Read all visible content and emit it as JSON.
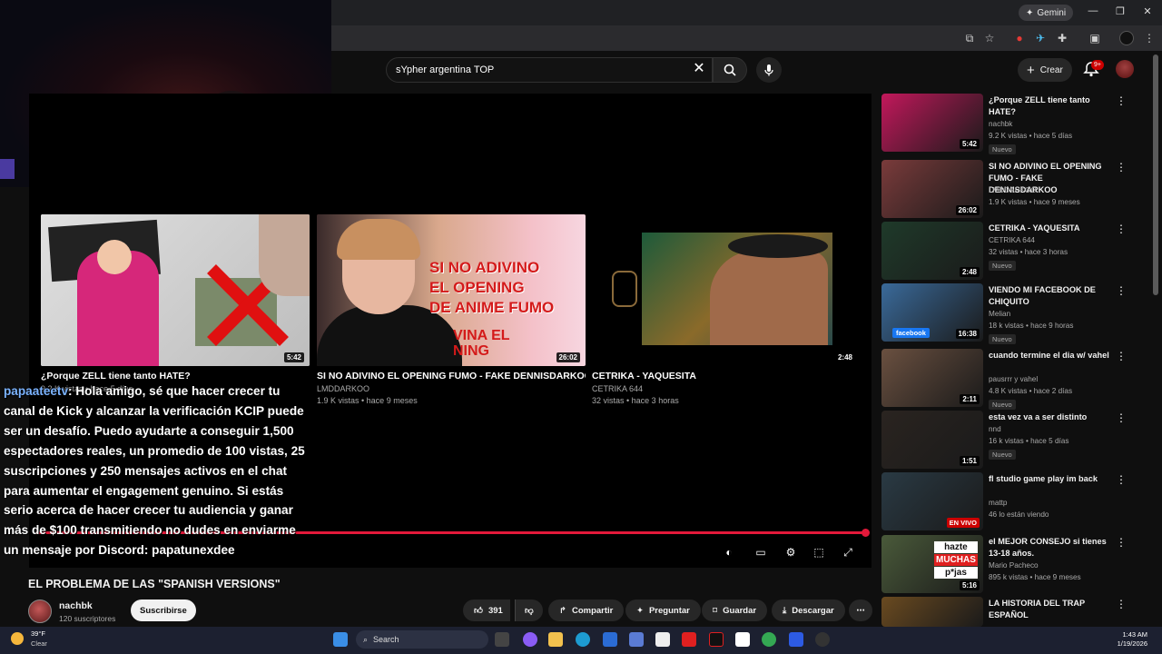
{
  "browser": {
    "gemini_label": "Gemini"
  },
  "youtube": {
    "search": {
      "query": "sYpher argentina TOP"
    },
    "create_label": "Crear",
    "notification_count": "9+"
  },
  "endscreen": [
    {
      "title": "¿Porque ZELL tiene tanto HATE?",
      "channel": "",
      "views": "9.2 K vistas • hace 5 días",
      "duration": "5:42"
    },
    {
      "title": "SI NO ADIVINO EL OPENING FUMO - FAKE DENNISDARKOO",
      "channel": "LMDDARKOO",
      "views": "1.9 K vistas • hace 9 meses",
      "duration": "26:02"
    },
    {
      "title": "CETRIKA - YAQUESITA",
      "channel": "CETRIKA 644",
      "views": "32 vistas • hace 3 horas",
      "duration": "2:48"
    }
  ],
  "thumb_text": {
    "t2_line1": "SI NO ADIVINO",
    "t2_line2": "EL OPENING",
    "t2_line3": "DE ANIME FUMO",
    "t2_line4": "VINA EL",
    "t2_line5": "NING"
  },
  "chat": {
    "username": "papaateetv",
    "message": ": Hola amigo, sé que hacer crecer tu canal de Kick y alcanzar la verificación KCIP puede ser un desafío. Puedo ayudarte a conseguir 1,500 espectadores reales, un promedio de 100 vistas, 25 suscripciones y 250 mensajes activos en el chat para aumentar el engagement genuino. Si estás serio acerca de hacer crecer tu audiencia y ganar más de $100 transmitiendo no dudes en enviarme un mensaje por Discord: papatunexdee"
  },
  "video": {
    "title": "EL PROBLEMA DE LAS \"SPANISH VERSIONS\"",
    "channel": "nachbk",
    "subscribers": "120 suscriptores",
    "subscribe_label": "Suscribirse",
    "likes": "391",
    "share_label": "Compartir",
    "ask_label": "Preguntar",
    "save_label": "Guardar",
    "download_label": "Descargar"
  },
  "recommendations": [
    {
      "title": "¿Porque ZELL tiene tanto HATE?",
      "channel": "nachbk",
      "views": "9.2 K vistas • hace 5 días",
      "badge": "Nuevo",
      "duration": "5:42",
      "color": "#c2185b"
    },
    {
      "title": "SI NO ADIVINO EL OPENING FUMO - FAKE DENNISDARKOO",
      "channel": "LMDDARKOO",
      "views": "1.9 K vistas • hace 9 meses",
      "badge": "",
      "duration": "26:02",
      "color": "#7a3b3b"
    },
    {
      "title": "CETRIKA - YAQUESITA",
      "channel": "CETRIKA 644",
      "views": "32 vistas • hace 3 horas",
      "badge": "Nuevo",
      "duration": "2:48",
      "color": "#1f3a2a"
    },
    {
      "title": "VIENDO MI FACEBOOK DE CHIQUITO",
      "channel": "Melian",
      "views": "18 k vistas • hace 9 horas",
      "badge": "Nuevo",
      "duration": "16:38",
      "color": "#3a6a9a"
    },
    {
      "title": "cuando termine el dia w/ vahel",
      "channel": "pausrrr y vahel",
      "views": "4.8 K vistas • hace 2 días",
      "badge": "Nuevo",
      "duration": "2:11",
      "color": "#6a5040"
    },
    {
      "title": "esta vez va a ser distinto",
      "channel": "nnd",
      "views": "16 k vistas • hace 5 días",
      "badge": "Nuevo",
      "duration": "1:51",
      "color": "#2a2420"
    },
    {
      "title": "fl studio game play im back",
      "channel": "mattp",
      "views": "46 lo están viendo",
      "badge": "",
      "duration": "EN VIVO",
      "color": "#2a3a44"
    },
    {
      "title": "el MEJOR CONSEJO si tienes 13-18 años.",
      "channel": "Mario Pacheco",
      "views": "895 k vistas • hace 9 meses",
      "badge": "",
      "duration": "5:16",
      "color": "#4a5a3a"
    },
    {
      "title": "LA HISTORIA DEL TRAP ESPAÑOL",
      "channel": "",
      "views": "",
      "badge": "",
      "duration": "",
      "color": "#6a4a20"
    }
  ],
  "rec_thumb_text": {
    "facebook": "facebook",
    "hazte_1": "hazte",
    "hazte_2": "MUCHAS",
    "hazte_3": "p*jas"
  },
  "taskbar": {
    "temp": "39°F",
    "condition": "Clear",
    "search_placeholder": "Search",
    "time": "1:43 AM",
    "date": "1/19/2026"
  }
}
